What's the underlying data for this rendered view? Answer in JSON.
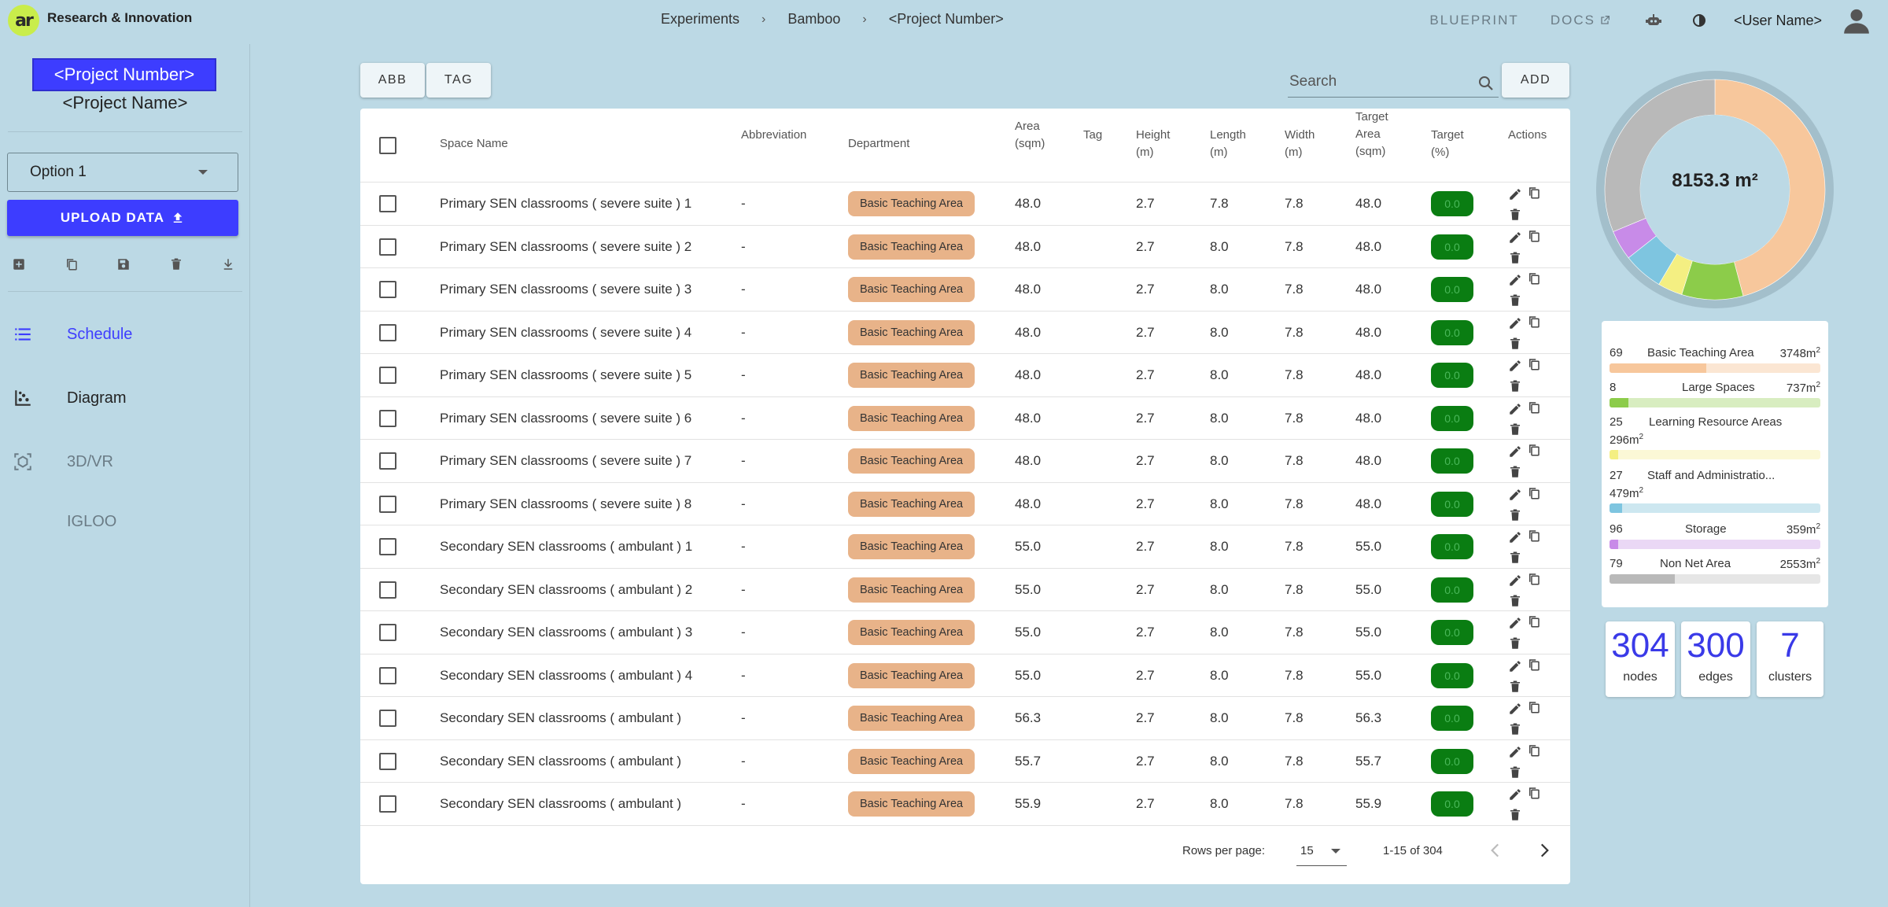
{
  "brand": "Research & Innovation",
  "logo": "ar",
  "breadcrumbs": [
    "Experiments",
    "Bamboo",
    "<Project Number>"
  ],
  "topnav": {
    "blueprint": "BLUEPRINT",
    "docs": "DOCS",
    "user_name": "<User Name>"
  },
  "sidebar": {
    "project_number": "<Project Number>",
    "project_name": "<Project Name>",
    "option": "Option 1",
    "upload_label": "UPLOAD DATA",
    "nav": [
      {
        "label": "Schedule",
        "color": "#3d3dff"
      },
      {
        "label": "Diagram",
        "color": "#222222"
      },
      {
        "label": "3D/VR",
        "color": "#6b7c86"
      },
      {
        "label": "IGLOO",
        "color": "#6b7c86"
      }
    ]
  },
  "toolbar": {
    "abb": "ABB",
    "tag": "TAG",
    "add": "ADD",
    "search_placeholder": "Search"
  },
  "table": {
    "headers": [
      "Space Name",
      "Abbreviation",
      "Department",
      "Area\n(sqm)",
      "Tag",
      "Height\n(m)",
      "Length\n(m)",
      "Width\n(m)",
      "Target\nArea\n(sqm)",
      "Target\n(%)",
      "Actions"
    ],
    "rows": [
      {
        "name": "Primary SEN classrooms ( severe suite ) 1",
        "abbr": "-",
        "dept": "Basic Teaching Area",
        "area": "48.0",
        "tag": "",
        "height": "2.7",
        "length": "7.8",
        "width": "7.8",
        "target_area": "48.0",
        "target_pct": "0.0"
      },
      {
        "name": "Primary SEN classrooms ( severe suite ) 2",
        "abbr": "-",
        "dept": "Basic Teaching Area",
        "area": "48.0",
        "tag": "",
        "height": "2.7",
        "length": "8.0",
        "width": "7.8",
        "target_area": "48.0",
        "target_pct": "0.0"
      },
      {
        "name": "Primary SEN classrooms ( severe suite ) 3",
        "abbr": "-",
        "dept": "Basic Teaching Area",
        "area": "48.0",
        "tag": "",
        "height": "2.7",
        "length": "8.0",
        "width": "7.8",
        "target_area": "48.0",
        "target_pct": "0.0"
      },
      {
        "name": "Primary SEN classrooms ( severe suite ) 4",
        "abbr": "-",
        "dept": "Basic Teaching Area",
        "area": "48.0",
        "tag": "",
        "height": "2.7",
        "length": "8.0",
        "width": "7.8",
        "target_area": "48.0",
        "target_pct": "0.0"
      },
      {
        "name": "Primary SEN classrooms ( severe suite ) 5",
        "abbr": "-",
        "dept": "Basic Teaching Area",
        "area": "48.0",
        "tag": "",
        "height": "2.7",
        "length": "8.0",
        "width": "7.8",
        "target_area": "48.0",
        "target_pct": "0.0"
      },
      {
        "name": "Primary SEN classrooms ( severe suite ) 6",
        "abbr": "-",
        "dept": "Basic Teaching Area",
        "area": "48.0",
        "tag": "",
        "height": "2.7",
        "length": "8.0",
        "width": "7.8",
        "target_area": "48.0",
        "target_pct": "0.0"
      },
      {
        "name": "Primary SEN classrooms ( severe suite ) 7",
        "abbr": "-",
        "dept": "Basic Teaching Area",
        "area": "48.0",
        "tag": "",
        "height": "2.7",
        "length": "8.0",
        "width": "7.8",
        "target_area": "48.0",
        "target_pct": "0.0"
      },
      {
        "name": "Primary SEN classrooms ( severe suite ) 8",
        "abbr": "-",
        "dept": "Basic Teaching Area",
        "area": "48.0",
        "tag": "",
        "height": "2.7",
        "length": "8.0",
        "width": "7.8",
        "target_area": "48.0",
        "target_pct": "0.0"
      },
      {
        "name": "Secondary SEN classrooms ( ambulant ) 1",
        "abbr": "-",
        "dept": "Basic Teaching Area",
        "area": "55.0",
        "tag": "",
        "height": "2.7",
        "length": "8.0",
        "width": "7.8",
        "target_area": "55.0",
        "target_pct": "0.0"
      },
      {
        "name": "Secondary SEN classrooms ( ambulant ) 2",
        "abbr": "-",
        "dept": "Basic Teaching Area",
        "area": "55.0",
        "tag": "",
        "height": "2.7",
        "length": "8.0",
        "width": "7.8",
        "target_area": "55.0",
        "target_pct": "0.0"
      },
      {
        "name": "Secondary SEN classrooms ( ambulant ) 3",
        "abbr": "-",
        "dept": "Basic Teaching Area",
        "area": "55.0",
        "tag": "",
        "height": "2.7",
        "length": "8.0",
        "width": "7.8",
        "target_area": "55.0",
        "target_pct": "0.0"
      },
      {
        "name": "Secondary SEN classrooms ( ambulant ) 4",
        "abbr": "-",
        "dept": "Basic Teaching Area",
        "area": "55.0",
        "tag": "",
        "height": "2.7",
        "length": "8.0",
        "width": "7.8",
        "target_area": "55.0",
        "target_pct": "0.0"
      },
      {
        "name": "Secondary SEN classrooms ( ambulant )",
        "abbr": "-",
        "dept": "Basic Teaching Area",
        "area": "56.3",
        "tag": "",
        "height": "2.7",
        "length": "8.0",
        "width": "7.8",
        "target_area": "56.3",
        "target_pct": "0.0"
      },
      {
        "name": "Secondary SEN classrooms ( ambulant )",
        "abbr": "-",
        "dept": "Basic Teaching Area",
        "area": "55.7",
        "tag": "",
        "height": "2.7",
        "length": "8.0",
        "width": "7.8",
        "target_area": "55.7",
        "target_pct": "0.0"
      },
      {
        "name": "Secondary SEN classrooms ( ambulant )",
        "abbr": "-",
        "dept": "Basic Teaching Area",
        "area": "55.9",
        "tag": "",
        "height": "2.7",
        "length": "8.0",
        "width": "7.8",
        "target_area": "55.9",
        "target_pct": "0.0"
      }
    ],
    "pagination": {
      "rows_per_page_label": "Rows per page:",
      "rows_per_page": "15",
      "range": "1-15 of 304"
    }
  },
  "summary": {
    "total_area": "8153.3 m²",
    "categories": [
      {
        "count": "69",
        "name": "Basic Teaching Area",
        "area": "3748m",
        "color": "#f7c79c",
        "track": "#fbe6d3",
        "fill": 0.46
      },
      {
        "count": "8",
        "name": "Large Spaces",
        "area": "737m",
        "color": "#8ccc4a",
        "track": "#d8edc0",
        "fill": 0.09
      },
      {
        "count": "25",
        "name": "Learning Resource Areas",
        "area": "296m",
        "color": "#f4ef82",
        "track": "#fbf8d6",
        "fill": 0.04
      },
      {
        "count": "27",
        "name": "Staff and Administratio...",
        "area": "479m",
        "color": "#7ec5e0",
        "track": "#cde7f0",
        "fill": 0.06
      },
      {
        "count": "96",
        "name": "Storage",
        "area": "359m",
        "color": "#c88be8",
        "track": "#ead8f5",
        "fill": 0.04
      },
      {
        "count": "79",
        "name": "Non Net Area",
        "area": "2553m",
        "color": "#b9b9b9",
        "track": "#e6e6e6",
        "fill": 0.31
      }
    ],
    "stats": [
      {
        "value": "304",
        "label": "nodes"
      },
      {
        "value": "300",
        "label": "edges"
      },
      {
        "value": "7",
        "label": "clusters"
      }
    ]
  },
  "colors": {
    "accent": "#3d3dff",
    "dept_badge": "#e8b389",
    "target_badge": "#0a7d12"
  }
}
